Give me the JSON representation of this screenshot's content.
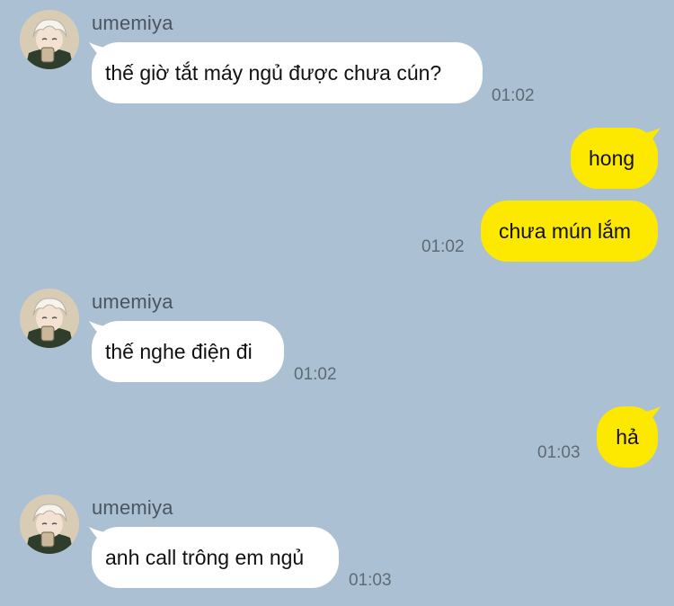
{
  "colors": {
    "background": "#abc1d3",
    "incoming_bubble": "#ffffff",
    "outgoing_bubble": "#fde800",
    "sender_text": "#4b5560",
    "time_text": "#5e6a74"
  },
  "messages": [
    {
      "sender": "umemiya",
      "text": "thế giờ tắt máy ngủ được chưa cún?",
      "time": "01:02"
    },
    {
      "text": "hong"
    },
    {
      "text": "chưa mún lắm",
      "time": "01:02"
    },
    {
      "sender": "umemiya",
      "text": "thế nghe điện đi",
      "time": "01:02"
    },
    {
      "text": "hả",
      "time": "01:03"
    },
    {
      "sender": "umemiya",
      "text": "anh call trông em ngủ",
      "time": "01:03"
    }
  ]
}
